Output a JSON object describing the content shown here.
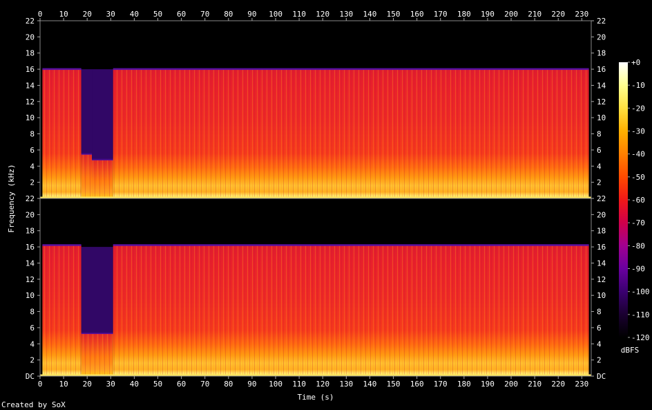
{
  "chart_data": {
    "type": "heatmap",
    "title": "",
    "xlabel": "Time (s)",
    "ylabel": "Frequency (kHz)",
    "xlim": [
      0,
      234
    ],
    "ylim_khz": [
      0,
      22
    ],
    "x_ticks": [
      "0",
      "10",
      "20",
      "30",
      "40",
      "50",
      "60",
      "70",
      "80",
      "90",
      "100",
      "110",
      "120",
      "130",
      "140",
      "150",
      "160",
      "170",
      "180",
      "190",
      "200",
      "210",
      "220",
      "230"
    ],
    "y_ticks": [
      "DC",
      "2",
      "4",
      "6",
      "8",
      "10",
      "12",
      "14",
      "16",
      "18",
      "20",
      "22"
    ],
    "channels": [
      {
        "segments": [
          {
            "t_start": 0,
            "t_end": 1,
            "cutoff_khz": 0
          },
          {
            "t_start": 1,
            "t_end": 17.5,
            "cutoff_khz": 16
          },
          {
            "t_start": 17.5,
            "t_end": 22,
            "cutoff_khz": 5.5
          },
          {
            "t_start": 22,
            "t_end": 31,
            "cutoff_khz": 4.8
          },
          {
            "t_start": 31,
            "t_end": 233,
            "cutoff_khz": 16
          },
          {
            "t_start": 233,
            "t_end": 234,
            "cutoff_khz": 0
          }
        ]
      },
      {
        "segments": [
          {
            "t_start": 0,
            "t_end": 1,
            "cutoff_khz": 0
          },
          {
            "t_start": 1,
            "t_end": 17.5,
            "cutoff_khz": 16.2
          },
          {
            "t_start": 17.5,
            "t_end": 31,
            "cutoff_khz": 5.3
          },
          {
            "t_start": 31,
            "t_end": 233,
            "cutoff_khz": 16.2
          },
          {
            "t_start": 233,
            "t_end": 234,
            "cutoff_khz": 0
          }
        ]
      }
    ],
    "colorbar": {
      "label": "dBFS",
      "range": [
        -120,
        0
      ],
      "ticks": [
        "+0",
        "-10",
        "-20",
        "-30",
        "-40",
        "-50",
        "-60",
        "-70",
        "-80",
        "-90",
        "-100",
        "-110",
        "-120"
      ],
      "stops": [
        "#000000",
        "#1a0030",
        "#3a0070",
        "#6a00a0",
        "#a00090",
        "#d0004a",
        "#f01818",
        "#ff4a00",
        "#ff8000",
        "#ffb000",
        "#ffe040",
        "#ffff90",
        "#ffffff"
      ]
    }
  },
  "footer": {
    "credit": "Created by SoX"
  }
}
